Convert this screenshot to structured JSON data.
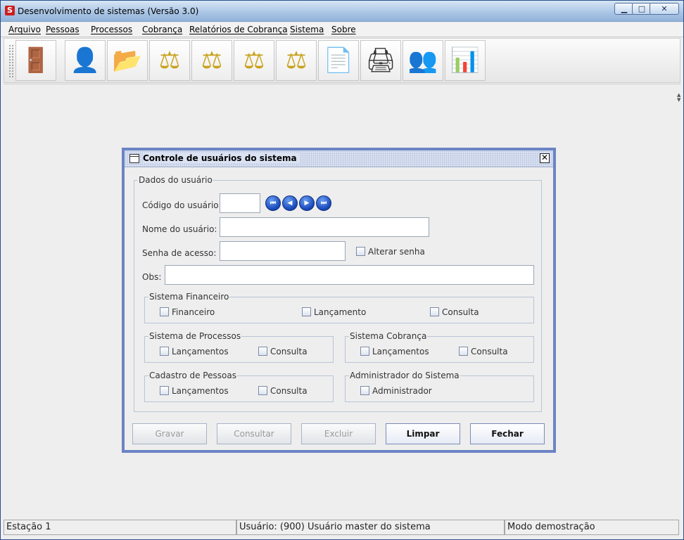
{
  "window": {
    "title": "Desenvolvimento de sistemas (Versão 3.0)",
    "controls": {
      "minimize": "▁",
      "maximize": "□",
      "close": "✕"
    }
  },
  "menu": [
    "Arquivo",
    "Pessoas",
    "Processos",
    "Cobrança",
    "Relatórios de Cobrança",
    "Sistema",
    "Sobre"
  ],
  "toolbar": {
    "buttons": [
      {
        "icon": "exit-door-icon",
        "glyph": "🚪"
      },
      {
        "icon": "user-icon",
        "glyph": "👤"
      },
      {
        "icon": "folder-person-icon",
        "glyph": "📂"
      },
      {
        "icon": "scales-icon",
        "glyph": "⚖"
      },
      {
        "icon": "scales-window-icon",
        "glyph": "⚖"
      },
      {
        "icon": "scales-money-icon",
        "glyph": "⚖"
      },
      {
        "icon": "scales-edit-icon",
        "glyph": "⚖"
      },
      {
        "icon": "document-icon",
        "glyph": "📄"
      },
      {
        "icon": "printer-icon",
        "glyph": "🖨"
      },
      {
        "icon": "users-icon",
        "glyph": "👥"
      },
      {
        "icon": "presentation-icon",
        "glyph": "📊"
      }
    ]
  },
  "dialog": {
    "title": "Controle de usuários do sistema",
    "close_glyph": "✕",
    "group_title": "Dados do usuário",
    "fields": {
      "codigo_label": "Código do usuário:",
      "codigo_value": "",
      "nome_label": "Nome do usuário:",
      "nome_value": "",
      "senha_label": "Senha de acesso:",
      "senha_value": "",
      "alterar_senha": "Alterar senha",
      "obs_label": "Obs:",
      "obs_value": ""
    },
    "nav": {
      "first": "⏮",
      "prev": "◀",
      "next": "▶",
      "last": "⏭"
    },
    "sistema_financeiro": {
      "title": "Sistema Financeiro",
      "items": [
        "Financeiro",
        "Lançamento",
        "Consulta"
      ]
    },
    "sistema_processos": {
      "title": "Sistema de Processos",
      "items": [
        "Lançamentos",
        "Consulta"
      ]
    },
    "sistema_cobranca": {
      "title": "Sistema Cobrança",
      "items": [
        "Lançamentos",
        "Consulta"
      ]
    },
    "cadastro_pessoas": {
      "title": "Cadastro de Pessoas",
      "items": [
        "Lançamentos",
        "Consulta"
      ]
    },
    "administrador": {
      "title": "Administrador do Sistema",
      "items": [
        "Administrador"
      ]
    },
    "buttons": {
      "gravar": "Gravar",
      "consultar": "Consultar",
      "excluir": "Excluir",
      "limpar": "Limpar",
      "fechar": "Fechar"
    }
  },
  "status": {
    "estacao": "Estação 1",
    "usuario": "Usuário: (900) Usuário master do sistema",
    "modo": "Modo demostração"
  }
}
